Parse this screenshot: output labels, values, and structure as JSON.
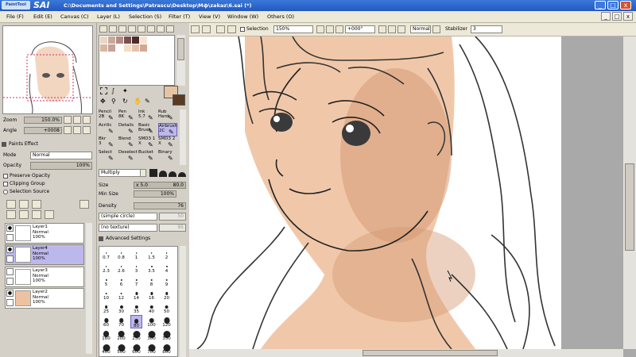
{
  "window": {
    "brand_small": "PaintTool",
    "brand": "SAI",
    "title_path": "C:\\Documents and Settings\\Patrascu\\Desktop\\Мф\\zakaz\\6.sai (*)",
    "controls": {
      "minimize": "_",
      "maximize": "□",
      "close": "x"
    }
  },
  "menu": {
    "items": [
      "File (F)",
      "Edit (E)",
      "Canvas (C)",
      "Layer (L)",
      "Selection (S)",
      "Filter (T)",
      "View (V)",
      "Window (W)",
      "Others (O)"
    ],
    "right": {
      "minimize": "_",
      "restore": "□",
      "close": "x"
    }
  },
  "navigator": {
    "zoom_label": "Zoom",
    "zoom_value": "150.0%",
    "angle_label": "Angle",
    "angle_value": "+0008"
  },
  "paint_effects": {
    "header": "Paints Effect",
    "mode_label": "Mode",
    "mode_value": "Normal",
    "opacity_label": "Opacity",
    "opacity_value": "100%",
    "preserve_opacity": "Preserve Opacity",
    "clipping_group": "Clipping Group",
    "selection_source": "Selection Source"
  },
  "layers": [
    {
      "name": "Layer1",
      "mode": "Normal",
      "opacity": "100%",
      "selected": false
    },
    {
      "name": "Layer4",
      "mode": "Normal",
      "opacity": "100%",
      "selected": true
    },
    {
      "name": "Layer3",
      "mode": "Normal",
      "opacity": "100%",
      "selected": false
    },
    {
      "name": "Layer2",
      "mode": "Normal",
      "opacity": "100%",
      "selected": false
    }
  ],
  "colors": {
    "primary": "#e8c3a2",
    "secondary": "#5a3b22",
    "swatches": [
      "#e9d6c6",
      "#c9a89a",
      "#b38b86",
      "#7a4e4e",
      "#4d2b2b",
      "#f5e3d3",
      "#d8b6a1",
      "#c7a29a",
      "#ffffff",
      "#f4ddc6",
      "#e6c2aa",
      "#d3a891"
    ],
    "canvas_skin": "#eec2a0",
    "canvas_shadow": "#d59a76"
  },
  "tools": [
    {
      "label": "Pencil",
      "size": "2B"
    },
    {
      "label": "Pen",
      "size": "8K"
    },
    {
      "label": "Ink",
      "size": "5.7"
    },
    {
      "label": "Rub",
      "size": "Hard"
    },
    {
      "label": "Acrilic",
      "size": ""
    },
    {
      "label": "Details",
      "size": ""
    },
    {
      "label": "Basic Brush",
      "size": ""
    },
    {
      "label": "Airbrush",
      "size": "2C"
    },
    {
      "label": "Bkr",
      "size": "3"
    },
    {
      "label": "Blend",
      "size": ""
    },
    {
      "label": "SMD3 1",
      "size": "X"
    },
    {
      "label": "SMD3 2",
      "size": "X"
    },
    {
      "label": "Select",
      "size": ""
    },
    {
      "label": "Deselect",
      "size": ""
    },
    {
      "label": "Bucket",
      "size": ""
    },
    {
      "label": "Binary",
      "size": ""
    }
  ],
  "brush_settings": {
    "blend_mode": "Multiply",
    "size_label": "Size",
    "size_mult": "x 5.0",
    "size_value": "80.0",
    "min_size_label": "Min Size",
    "min_size_value": "100%",
    "density_label": "Density",
    "density_value": "76",
    "shape": "(simple circle)",
    "shape_value": "50",
    "texture": "(no texture)",
    "texture_value": "95",
    "advanced": "Advanced Settings",
    "sizes": [
      "0.7",
      "0.8",
      "1",
      "1.5",
      "2",
      "2.3",
      "2.6",
      "3",
      "3.5",
      "4",
      "5",
      "6",
      "7",
      "8",
      "9",
      "10",
      "12",
      "14",
      "16",
      "20",
      "25",
      "30",
      "35",
      "40",
      "50",
      "60",
      "70",
      "80",
      "100",
      "120",
      "160",
      "200",
      "250",
      "300",
      "350",
      "400",
      "500",
      "600",
      "700",
      "800"
    ]
  },
  "toolbar": {
    "selection_label": "Selection",
    "zoom": "150%",
    "angle": "+000°",
    "blend": "Normal",
    "stabilizer_label": "Stabilizer",
    "stabilizer_value": "3"
  }
}
